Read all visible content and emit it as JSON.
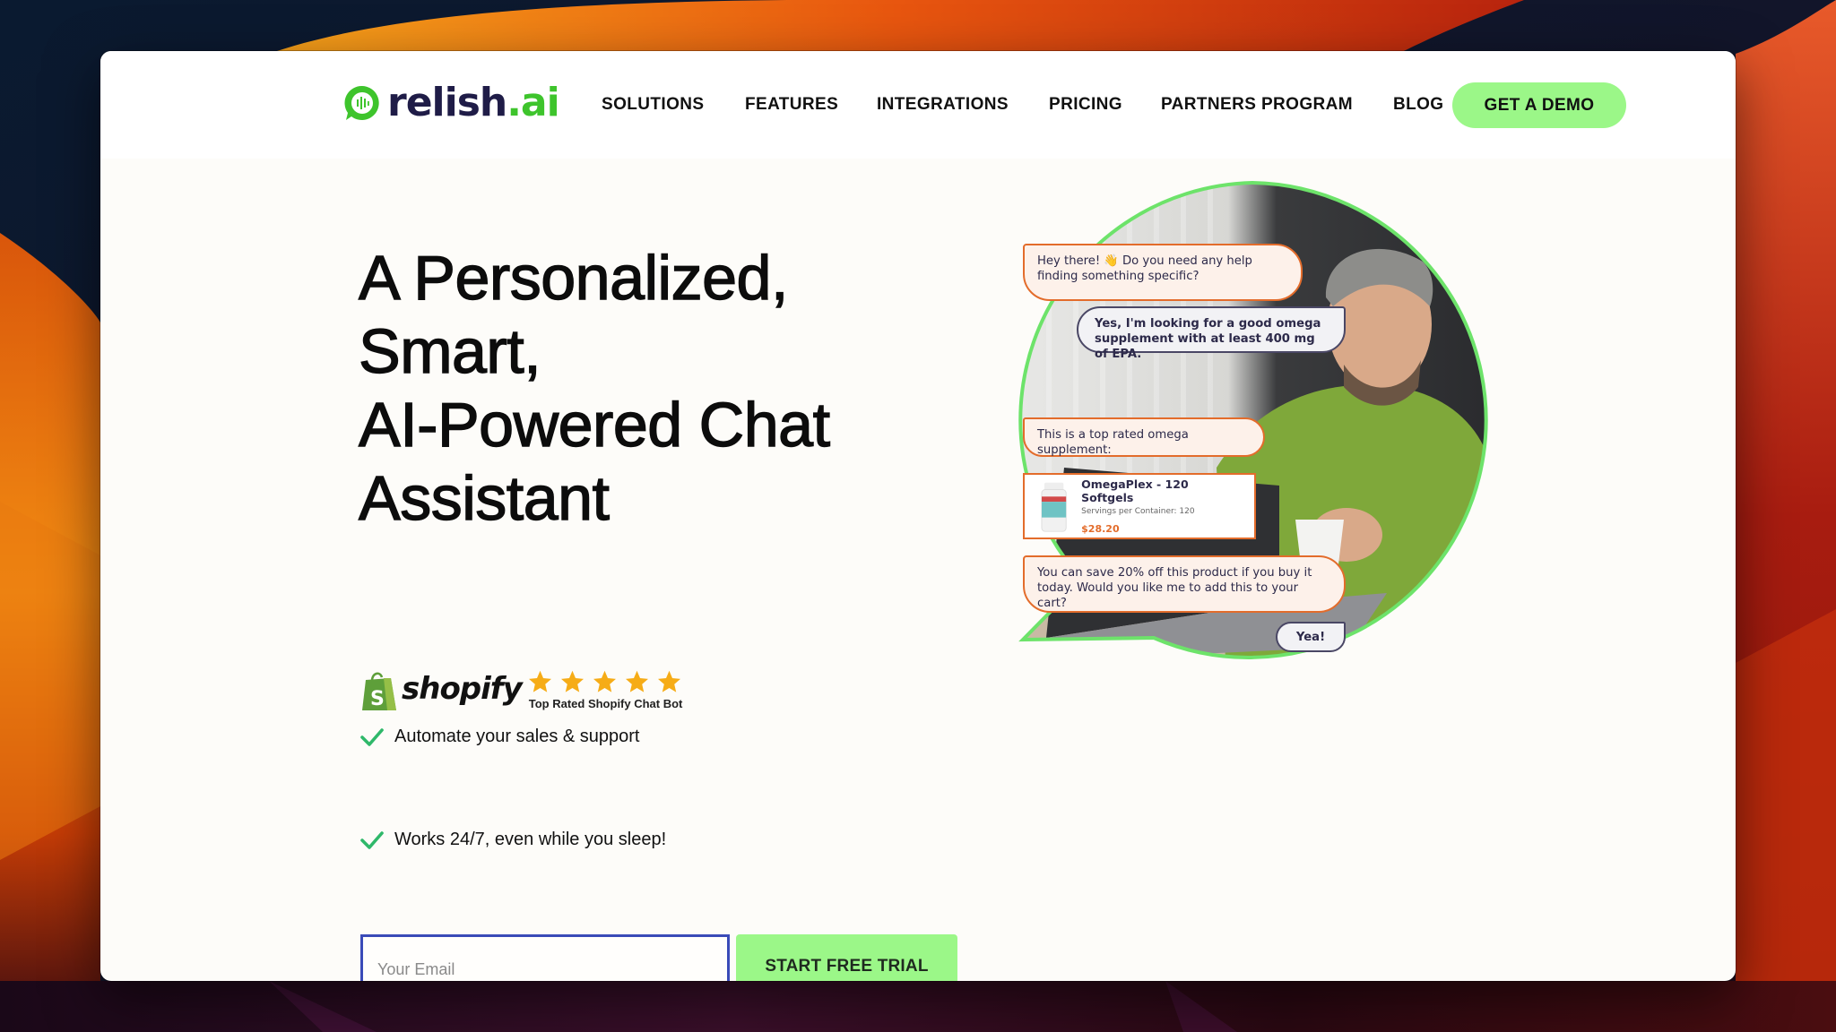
{
  "brand": {
    "name": "relish",
    "tld": ".ai",
    "logo_icon": "chat-bubble-soundwave-icon",
    "colors": {
      "primary_dark": "#1f1c47",
      "accent_green": "#3ec42c",
      "button_green": "#9bf788",
      "bot_orange": "#e36c2b"
    }
  },
  "nav": {
    "items": [
      {
        "label": "SOLUTIONS"
      },
      {
        "label": "FEATURES"
      },
      {
        "label": "INTEGRATIONS"
      },
      {
        "label": "PRICING"
      },
      {
        "label": "PARTNERS PROGRAM"
      },
      {
        "label": "BLOG"
      }
    ],
    "cta_label": "GET A DEMO"
  },
  "hero": {
    "title_lines": [
      "A Personalized,",
      "Smart,",
      "AI-Powered Chat",
      "Assistant"
    ],
    "shopify": {
      "wordmark": "shopify",
      "rating": 5,
      "rating_max": 5,
      "rating_label": "Top Rated Shopify Chat Bot"
    },
    "features": [
      {
        "icon": "check-icon",
        "text": "Automate your sales & support"
      },
      {
        "icon": "check-icon",
        "text": "Works 24/7, even while you sleep!"
      }
    ],
    "signup": {
      "email_placeholder": "Your Email",
      "email_value": "",
      "submit_label": "START FREE TRIAL"
    }
  },
  "chat_demo": {
    "messages": [
      {
        "from": "bot",
        "text": "Hey there! 👋  Do you need any help finding something specific?"
      },
      {
        "from": "user",
        "text": "Yes, I'm looking for a good omega supplement with at least 400 mg of EPA."
      },
      {
        "from": "bot",
        "text": "This is a top rated omega supplement:"
      },
      {
        "from": "bot",
        "text": "You can save 20% off this product if you buy it today. Would you like me to add this to your cart?"
      },
      {
        "from": "user",
        "text": "Yea!"
      }
    ],
    "product": {
      "name": "OmegaPlex - 120 Softgels",
      "subtitle": "Servings per Container: 120",
      "price": "$28.20"
    }
  }
}
